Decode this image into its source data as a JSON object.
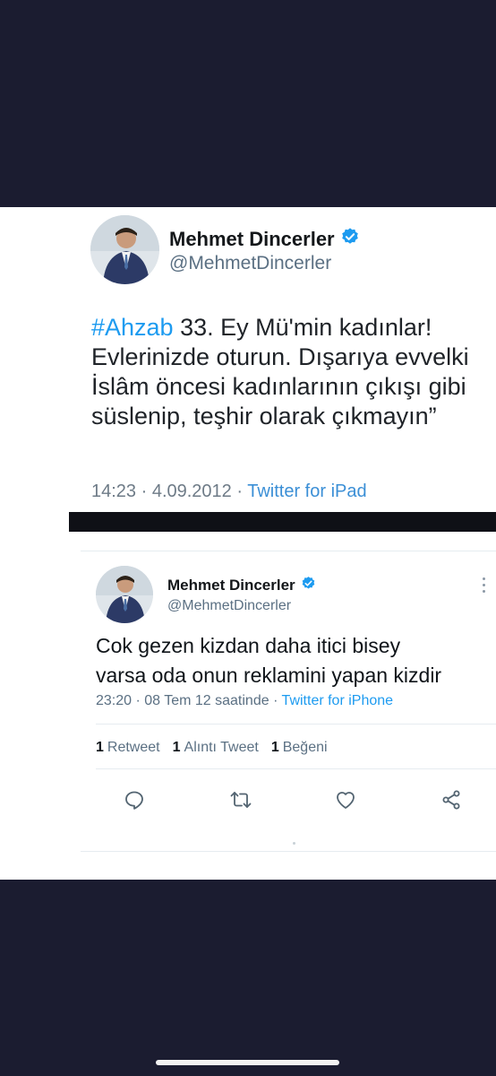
{
  "tweet1": {
    "name": "Mehmet Dincerler",
    "handle": "@MehmetDincerler",
    "hashtag": "#Ahzab",
    "line1_rest": " 33. Ey Mü'min kadınlar!",
    "line2": "Evlerinizde oturun. Dışarıya evvelki",
    "line3": "İslâm öncesi kadınlarının çıkışı gibi",
    "line4": "süslenip,  teşhir olarak çıkmayın”",
    "timestamp": "14:23 · 4.09.2012 · ",
    "source": "Twitter for iPad"
  },
  "tweet2": {
    "name": "Mehmet Dincerler",
    "handle": "@MehmetDincerler",
    "line1": "Cok gezen kizdan daha itici bisey",
    "line2": "varsa oda onun reklamini yapan kizdir",
    "timestamp": "23:20 · 08 Tem 12 saatinde · ",
    "source": "Twitter for iPhone",
    "stats": {
      "retweet_count": "1",
      "retweet_label": "Retweet",
      "quote_count": "1",
      "quote_label": "Alıntı Tweet",
      "like_count": "1",
      "like_label": "Beğeni"
    },
    "actions": [
      "reply-icon",
      "retweet-icon",
      "like-icon",
      "share-icon"
    ]
  },
  "colors": {
    "background": "#1b1c30",
    "panel": "#ffffff",
    "link": "#1d9bf0",
    "verified": "#1d9bf0",
    "secondary_text": "#5b7083"
  }
}
